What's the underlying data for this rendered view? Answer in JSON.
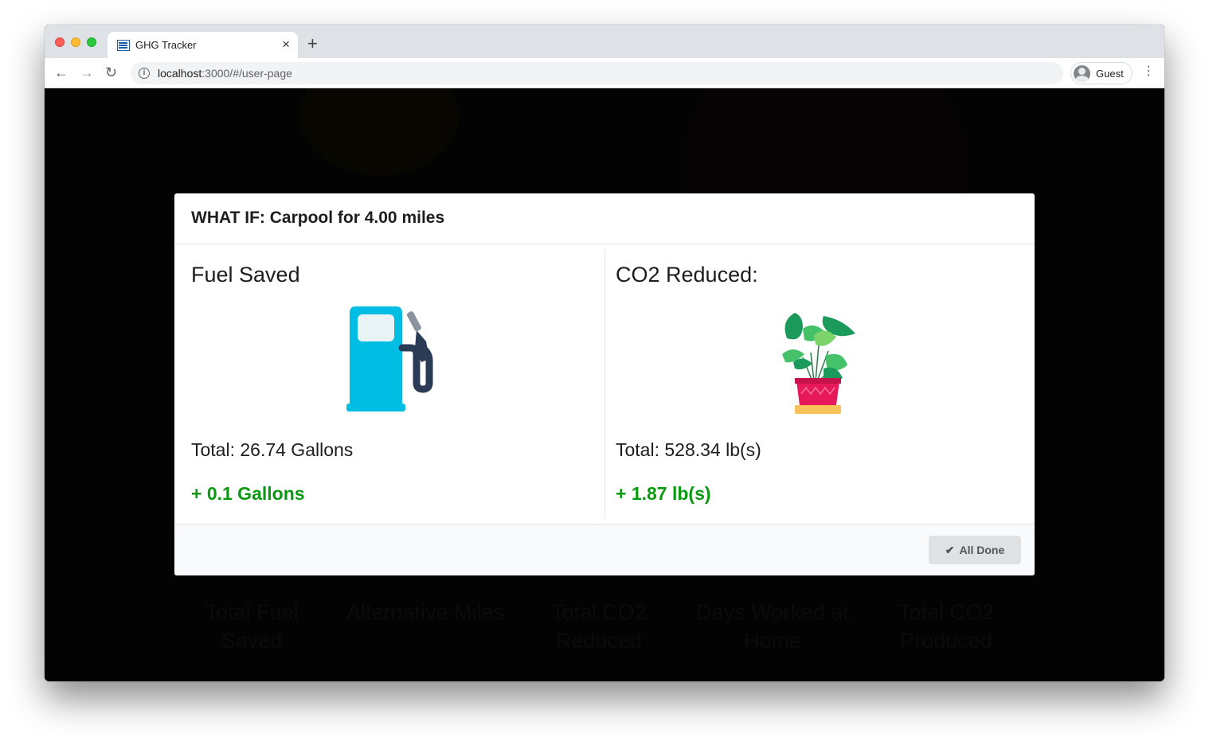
{
  "browser": {
    "tab_title": "GHG Tracker",
    "tab_close": "×",
    "new_tab": "+",
    "url_host": "localhost",
    "url_rest": ":3000/#/user-page",
    "profile_label": "Guest",
    "back": "←",
    "forward": "→",
    "reload": "↻",
    "menu": "⋮",
    "info": "i"
  },
  "background_stats": [
    "Total Fuel Saved",
    "Alternative Miles",
    "Total CO2 Reduced",
    "Days Worked at Home",
    "Total CO2 Produced"
  ],
  "modal": {
    "title": "WHAT IF: Carpool for 4.00 miles",
    "fuel": {
      "heading": "Fuel Saved",
      "total": "Total: 26.74 Gallons",
      "delta": "+ 0.1 Gallons",
      "icon": "gas-pump-icon"
    },
    "co2": {
      "heading": "CO2 Reduced:",
      "total": "Total: 528.34 lb(s)",
      "delta": "+ 1.87 lb(s)",
      "icon": "potted-plant-icon"
    },
    "done_label": "All Done",
    "done_icon": "✔"
  },
  "colors": {
    "delta_green": "#0a9a12",
    "pump_blue": "#00bde3",
    "hose_navy": "#2b3a55",
    "pot_pink": "#e8195a",
    "pot_base": "#f7c35a"
  }
}
